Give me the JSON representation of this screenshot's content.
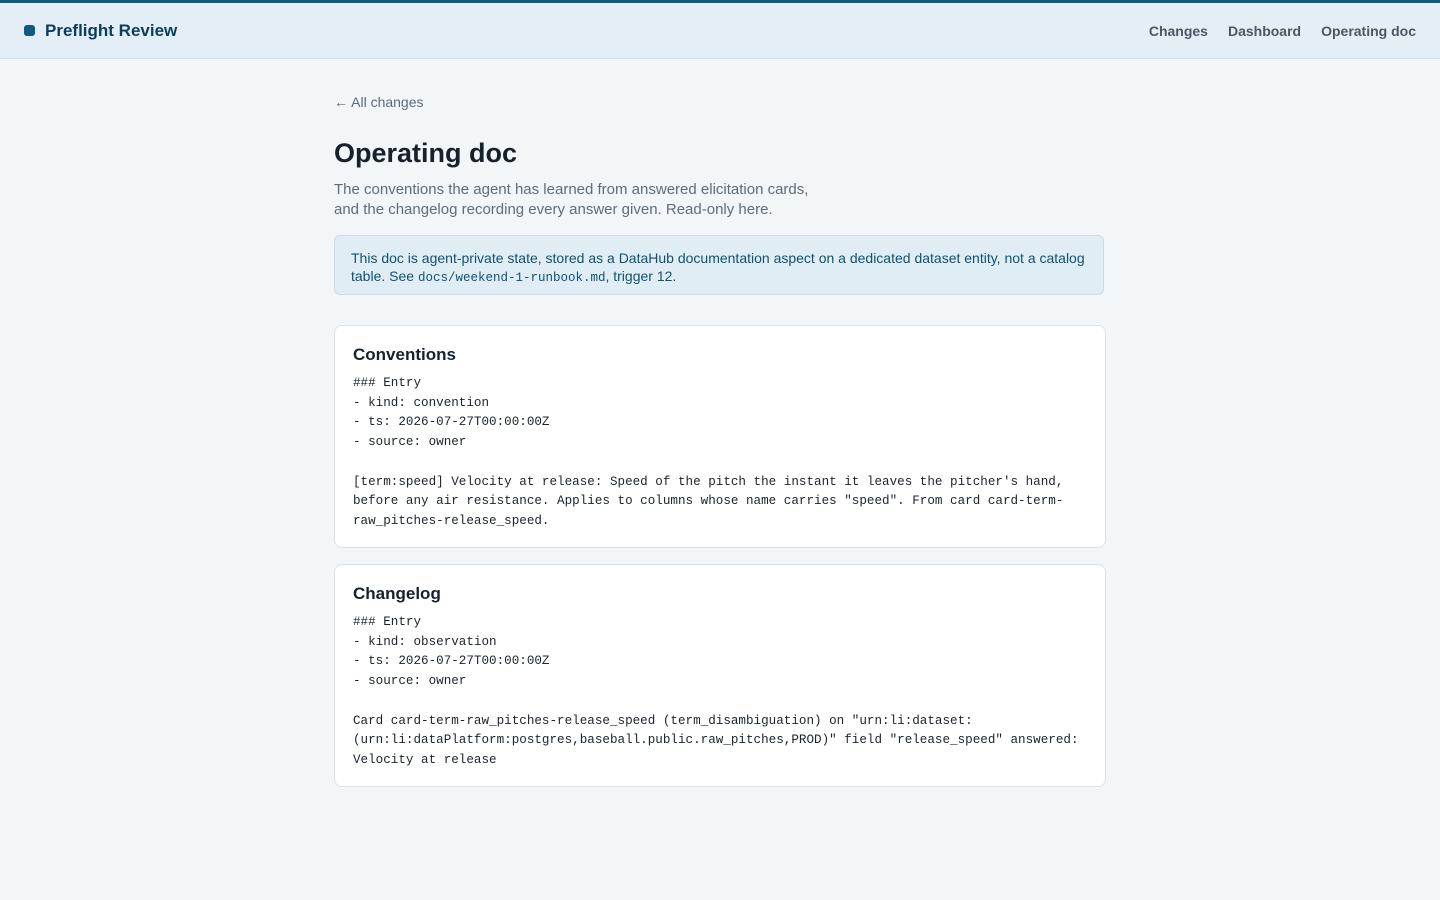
{
  "app": {
    "title": "Preflight Review"
  },
  "nav": {
    "items": [
      "Changes",
      "Dashboard",
      "Operating doc"
    ]
  },
  "page": {
    "back_label": "← All changes",
    "title": "Operating doc",
    "subtitle": "The conventions the agent has learned from answered elicitation cards, and the changelog recording every answer given. Read-only here."
  },
  "notice": {
    "text_before": "This doc is agent-private state, stored as a DataHub documentation aspect on a dedicated dataset entity, not a catalog table. See ",
    "code": "docs/weekend-1-runbook.md",
    "text_after": ", trigger 12."
  },
  "sections": [
    {
      "title": "Conventions",
      "body": "### Entry\n- kind: convention\n- ts: 2026-07-27T00:00:00Z\n- source: owner\n\n[term:speed] Velocity at release: Speed of the pitch the instant it leaves the pitcher's hand, before any air resistance. Applies to columns whose name carries \"speed\". From card card-term-raw_pitches-release_speed."
    },
    {
      "title": "Changelog",
      "body": "### Entry\n- kind: observation\n- ts: 2026-07-27T00:00:00Z\n- source: owner\n\nCard card-term-raw_pitches-release_speed (term_disambiguation) on \"urn:li:dataset:(urn:li:dataPlatform:postgres,baseball.public.raw_pitches,PROD)\" field \"release_speed\" answered: Velocity at release"
    }
  ],
  "colors": {
    "accent": "#0f5a80",
    "header_bg": "#e3eef6",
    "page_bg": "#f2f6f9",
    "notice_bg": "#e1edf5",
    "notice_text": "#0f5273"
  }
}
